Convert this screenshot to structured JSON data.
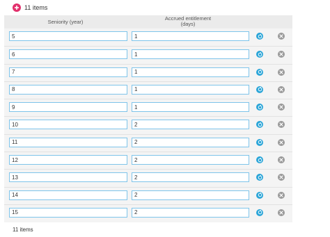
{
  "toolbar": {
    "item_count": "11 items"
  },
  "table": {
    "columns": [
      {
        "label": "Seniority (year)"
      },
      {
        "label": "Accrued entitlement",
        "sublabel": "(days)"
      }
    ],
    "rows": [
      {
        "seniority": "5",
        "days": "1"
      },
      {
        "seniority": "6",
        "days": "1"
      },
      {
        "seniority": "7",
        "days": "1"
      },
      {
        "seniority": "8",
        "days": "1"
      },
      {
        "seniority": "9",
        "days": "1"
      },
      {
        "seniority": "10",
        "days": "2"
      },
      {
        "seniority": "11",
        "days": "2"
      },
      {
        "seniority": "12",
        "days": "2"
      },
      {
        "seniority": "13",
        "days": "2"
      },
      {
        "seniority": "14",
        "days": "2"
      },
      {
        "seniority": "15",
        "days": "2"
      }
    ]
  },
  "footer": {
    "item_count": "11 items"
  },
  "icons": {
    "add": "plus-circle-icon",
    "edit": "edit-circle-icon",
    "delete": "close-circle-icon"
  },
  "colors": {
    "add_accent": "#e2306c",
    "edit_accent": "#2aa5d8",
    "delete_accent": "#9a9a9a",
    "input_border": "#7ec4ea"
  }
}
